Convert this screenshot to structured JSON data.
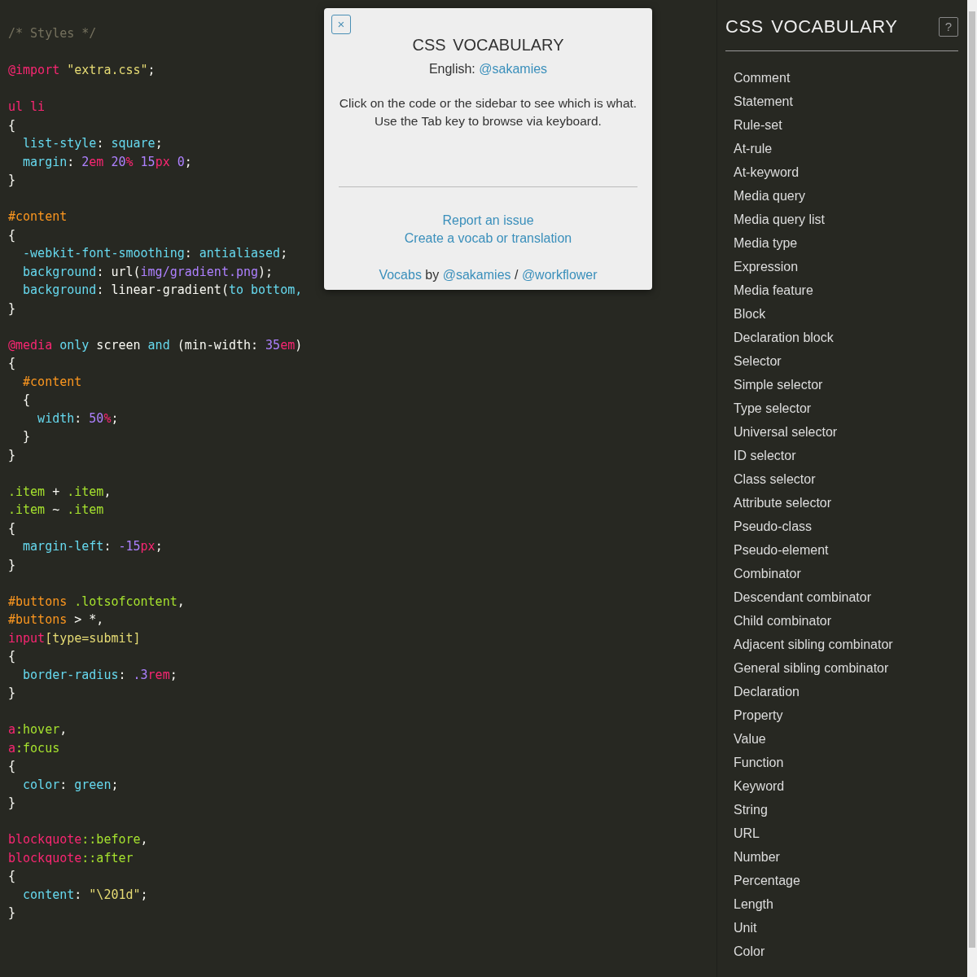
{
  "code_lines": [
    {
      "kind": "code",
      "tokens": [
        {
          "kind": "comment",
          "text": "/* Styles */"
        }
      ]
    },
    {
      "kind": "blank"
    },
    {
      "kind": "code",
      "tokens": [
        {
          "kind": "atrule",
          "text": "@import "
        },
        {
          "kind": "string",
          "text": "\"extra.css\""
        },
        {
          "kind": "plain",
          "text": ";"
        }
      ]
    },
    {
      "kind": "blank"
    },
    {
      "kind": "code",
      "tokens": [
        {
          "kind": "tag",
          "text": "ul li"
        }
      ]
    },
    {
      "kind": "code",
      "tokens": [
        {
          "kind": "plain",
          "text": "{"
        }
      ]
    },
    {
      "kind": "code",
      "tokens": [
        {
          "kind": "property",
          "text": "  list-style"
        },
        {
          "kind": "plain",
          "text": ": "
        },
        {
          "kind": "keyword",
          "text": "square"
        },
        {
          "kind": "plain",
          "text": ";"
        }
      ]
    },
    {
      "kind": "code",
      "tokens": [
        {
          "kind": "property",
          "text": "  margin"
        },
        {
          "kind": "plain",
          "text": ": "
        },
        {
          "kind": "number",
          "text": "2"
        },
        {
          "kind": "unit",
          "text": "em "
        },
        {
          "kind": "number",
          "text": "20"
        },
        {
          "kind": "unit",
          "text": "% "
        },
        {
          "kind": "number",
          "text": "15"
        },
        {
          "kind": "unit",
          "text": "px "
        },
        {
          "kind": "number",
          "text": "0"
        },
        {
          "kind": "plain",
          "text": ";"
        }
      ]
    },
    {
      "kind": "code",
      "tokens": [
        {
          "kind": "plain",
          "text": "}"
        }
      ]
    },
    {
      "kind": "blank"
    },
    {
      "kind": "code",
      "tokens": [
        {
          "kind": "id",
          "text": "#content"
        }
      ]
    },
    {
      "kind": "code",
      "tokens": [
        {
          "kind": "plain",
          "text": "{"
        }
      ]
    },
    {
      "kind": "code",
      "tokens": [
        {
          "kind": "property",
          "text": "  -webkit-font-smoothing"
        },
        {
          "kind": "plain",
          "text": ": "
        },
        {
          "kind": "keyword",
          "text": "antialiased"
        },
        {
          "kind": "plain",
          "text": ";"
        }
      ]
    },
    {
      "kind": "code",
      "tokens": [
        {
          "kind": "property",
          "text": "  background"
        },
        {
          "kind": "plain",
          "text": ": url("
        },
        {
          "kind": "number",
          "text": "img/gradient.png"
        },
        {
          "kind": "plain",
          "text": ");"
        }
      ]
    },
    {
      "kind": "code",
      "tokens": [
        {
          "kind": "property",
          "text": "  background"
        },
        {
          "kind": "plain",
          "text": ": linear-gradient("
        },
        {
          "kind": "keyword",
          "text": "to bottom,"
        }
      ]
    },
    {
      "kind": "code",
      "tokens": [
        {
          "kind": "plain",
          "text": "}"
        }
      ]
    },
    {
      "kind": "blank"
    },
    {
      "kind": "code",
      "tokens": [
        {
          "kind": "atrule",
          "text": "@media "
        },
        {
          "kind": "keyword",
          "text": "only"
        },
        {
          "kind": "plain",
          "text": " screen "
        },
        {
          "kind": "keyword",
          "text": "and"
        },
        {
          "kind": "plain",
          "text": " (min-width: "
        },
        {
          "kind": "number",
          "text": "35"
        },
        {
          "kind": "unit",
          "text": "em"
        },
        {
          "kind": "plain",
          "text": ")"
        }
      ]
    },
    {
      "kind": "code",
      "tokens": [
        {
          "kind": "plain",
          "text": "{"
        }
      ]
    },
    {
      "kind": "code",
      "tokens": [
        {
          "kind": "id",
          "text": "  #content"
        }
      ]
    },
    {
      "kind": "code",
      "tokens": [
        {
          "kind": "plain",
          "text": "  {"
        }
      ]
    },
    {
      "kind": "code",
      "tokens": [
        {
          "kind": "property",
          "text": "    width"
        },
        {
          "kind": "plain",
          "text": ": "
        },
        {
          "kind": "number",
          "text": "50"
        },
        {
          "kind": "unit",
          "text": "%"
        },
        {
          "kind": "plain",
          "text": ";"
        }
      ]
    },
    {
      "kind": "code",
      "tokens": [
        {
          "kind": "plain",
          "text": "  }"
        }
      ]
    },
    {
      "kind": "code",
      "tokens": [
        {
          "kind": "plain",
          "text": "}"
        }
      ]
    },
    {
      "kind": "blank"
    },
    {
      "kind": "code",
      "tokens": [
        {
          "kind": "class",
          "text": ".item"
        },
        {
          "kind": "plain",
          "text": " + "
        },
        {
          "kind": "class",
          "text": ".item"
        },
        {
          "kind": "plain",
          "text": ","
        }
      ]
    },
    {
      "kind": "code",
      "tokens": [
        {
          "kind": "class",
          "text": ".item"
        },
        {
          "kind": "plain",
          "text": " ~ "
        },
        {
          "kind": "class",
          "text": ".item"
        }
      ]
    },
    {
      "kind": "code",
      "tokens": [
        {
          "kind": "plain",
          "text": "{"
        }
      ]
    },
    {
      "kind": "code",
      "tokens": [
        {
          "kind": "property",
          "text": "  margin-left"
        },
        {
          "kind": "plain",
          "text": ": "
        },
        {
          "kind": "number",
          "text": "-15"
        },
        {
          "kind": "unit",
          "text": "px"
        },
        {
          "kind": "plain",
          "text": ";"
        }
      ]
    },
    {
      "kind": "code",
      "tokens": [
        {
          "kind": "plain",
          "text": "}"
        }
      ]
    },
    {
      "kind": "blank"
    },
    {
      "kind": "code",
      "tokens": [
        {
          "kind": "id",
          "text": "#buttons "
        },
        {
          "kind": "class",
          "text": ".lotsofcontent"
        },
        {
          "kind": "plain",
          "text": ","
        }
      ]
    },
    {
      "kind": "code",
      "tokens": [
        {
          "kind": "id",
          "text": "#buttons"
        },
        {
          "kind": "plain",
          "text": " > *,"
        }
      ]
    },
    {
      "kind": "code",
      "tokens": [
        {
          "kind": "tag",
          "text": "input"
        },
        {
          "kind": "string",
          "text": "[type=submit]"
        }
      ]
    },
    {
      "kind": "code",
      "tokens": [
        {
          "kind": "plain",
          "text": "{"
        }
      ]
    },
    {
      "kind": "code",
      "tokens": [
        {
          "kind": "property",
          "text": "  border-radius"
        },
        {
          "kind": "plain",
          "text": ": "
        },
        {
          "kind": "number",
          "text": ".3"
        },
        {
          "kind": "unit",
          "text": "rem"
        },
        {
          "kind": "plain",
          "text": ";"
        }
      ]
    },
    {
      "kind": "code",
      "tokens": [
        {
          "kind": "plain",
          "text": "}"
        }
      ]
    },
    {
      "kind": "blank"
    },
    {
      "kind": "code",
      "tokens": [
        {
          "kind": "tag",
          "text": "a"
        },
        {
          "kind": "class",
          "text": ":hover"
        },
        {
          "kind": "plain",
          "text": ","
        }
      ]
    },
    {
      "kind": "code",
      "tokens": [
        {
          "kind": "tag",
          "text": "a"
        },
        {
          "kind": "class",
          "text": ":focus"
        }
      ]
    },
    {
      "kind": "code",
      "tokens": [
        {
          "kind": "plain",
          "text": "{"
        }
      ]
    },
    {
      "kind": "code",
      "tokens": [
        {
          "kind": "property",
          "text": "  color"
        },
        {
          "kind": "plain",
          "text": ": "
        },
        {
          "kind": "keyword",
          "text": "green"
        },
        {
          "kind": "plain",
          "text": ";"
        }
      ]
    },
    {
      "kind": "code",
      "tokens": [
        {
          "kind": "plain",
          "text": "}"
        }
      ]
    },
    {
      "kind": "blank"
    },
    {
      "kind": "code",
      "tokens": [
        {
          "kind": "tag",
          "text": "blockquote"
        },
        {
          "kind": "class",
          "text": "::before"
        },
        {
          "kind": "plain",
          "text": ","
        }
      ]
    },
    {
      "kind": "code",
      "tokens": [
        {
          "kind": "tag",
          "text": "blockquote"
        },
        {
          "kind": "class",
          "text": "::after"
        }
      ]
    },
    {
      "kind": "code",
      "tokens": [
        {
          "kind": "plain",
          "text": "{"
        }
      ]
    },
    {
      "kind": "code",
      "tokens": [
        {
          "kind": "property",
          "text": "  content"
        },
        {
          "kind": "plain",
          "text": ": "
        },
        {
          "kind": "string",
          "text": "\"\\201d\""
        },
        {
          "kind": "plain",
          "text": ";"
        }
      ]
    },
    {
      "kind": "code",
      "tokens": [
        {
          "kind": "plain",
          "text": "}"
        }
      ]
    }
  ],
  "dialog": {
    "close": "×",
    "title": "CSS VOCABULARY",
    "author_label": "English:",
    "author_link": "@sakamies",
    "intro": [
      "Click on the code or the sidebar to see which is what.",
      "Use the Tab key to browse via keyboard."
    ],
    "links": [
      "Report an issue",
      "Create a vocab or translation"
    ],
    "credits": {
      "link": "Vocabs",
      "by": "by",
      "author_1": "@sakamies",
      "separator": "/",
      "author_2": "@workflower"
    }
  },
  "sidebar": {
    "title": "CSS VOCABULARY",
    "help": "?",
    "items": [
      "Comment",
      "Statement",
      "Rule-set",
      "At-rule",
      "At-keyword",
      "Media query",
      "Media query list",
      "Media type",
      "Expression",
      "Media feature",
      "Block",
      "Declaration block",
      "Selector",
      "Simple selector",
      "Type selector",
      "Universal selector",
      "ID selector",
      "Class selector",
      "Attribute selector",
      "Pseudo-class",
      "Pseudo-element",
      "Combinator",
      "Descendant combinator",
      "Child combinator",
      "Adjacent sibling combinator",
      "General sibling combinator",
      "Declaration",
      "Property",
      "Value",
      "Function",
      "Keyword",
      "String",
      "URL",
      "Number",
      "Percentage",
      "Length",
      "Unit",
      "Color"
    ]
  }
}
